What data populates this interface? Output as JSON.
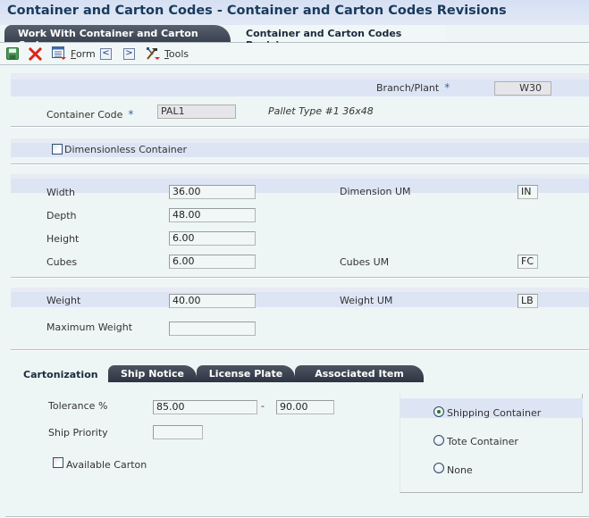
{
  "window": {
    "title": "Container and Carton Codes - Container and Carton Codes Revisions"
  },
  "tabs": [
    {
      "label": "Work With Container and Carton Codes",
      "active": true
    },
    {
      "label": "Container and Carton Codes Revisions",
      "active": false
    }
  ],
  "toolbar": {
    "save_icon": "floppy-disk-icon",
    "cancel_icon": "red-x-icon",
    "form_label": "Form",
    "form_mnemonic": "F",
    "form_rest": "orm",
    "prev_label": "<",
    "next_label": ">",
    "tools_label": "Tools",
    "tools_mnemonic": "T",
    "tools_rest": "ools"
  },
  "header": {
    "branch_plant_label": "Branch/Plant",
    "branch_plant_value": "W30",
    "container_code_label": "Container Code",
    "container_code_value": "PAL1",
    "container_description": "Pallet Type #1 36x48",
    "required_marker": "*"
  },
  "dimensionless": {
    "label": "Dimensionless Container",
    "checked": false
  },
  "dimensions": {
    "width_label": "Width",
    "width_value": "36.00",
    "depth_label": "Depth",
    "depth_value": "48.00",
    "height_label": "Height",
    "height_value": "6.00",
    "cubes_label": "Cubes",
    "cubes_value": "6.00",
    "dimension_um_label": "Dimension UM",
    "dimension_um_value": "IN",
    "cubes_um_label": "Cubes UM",
    "cubes_um_value": "FC"
  },
  "weights": {
    "weight_label": "Weight",
    "weight_value": "40.00",
    "max_weight_label": "Maximum Weight",
    "max_weight_value": "",
    "weight_um_label": "Weight UM",
    "weight_um_value": "LB"
  },
  "subtabs": [
    {
      "label": "Cartonization",
      "active": true
    },
    {
      "label": "Ship Notice",
      "active": false
    },
    {
      "label": "License Plate",
      "active": false
    },
    {
      "label": "Associated Item",
      "active": false
    }
  ],
  "cartonization": {
    "tolerance_label": "Tolerance %",
    "tolerance_from": "85.00",
    "tolerance_separator": "-",
    "tolerance_to": "90.00",
    "ship_priority_label": "Ship Priority",
    "ship_priority_value": "",
    "available_carton_label": "Available Carton",
    "available_carton_checked": false,
    "container_type_options": [
      {
        "label": "Shipping Container",
        "selected": true
      },
      {
        "label": "Tote Container",
        "selected": false
      },
      {
        "label": "None",
        "selected": false
      }
    ]
  }
}
